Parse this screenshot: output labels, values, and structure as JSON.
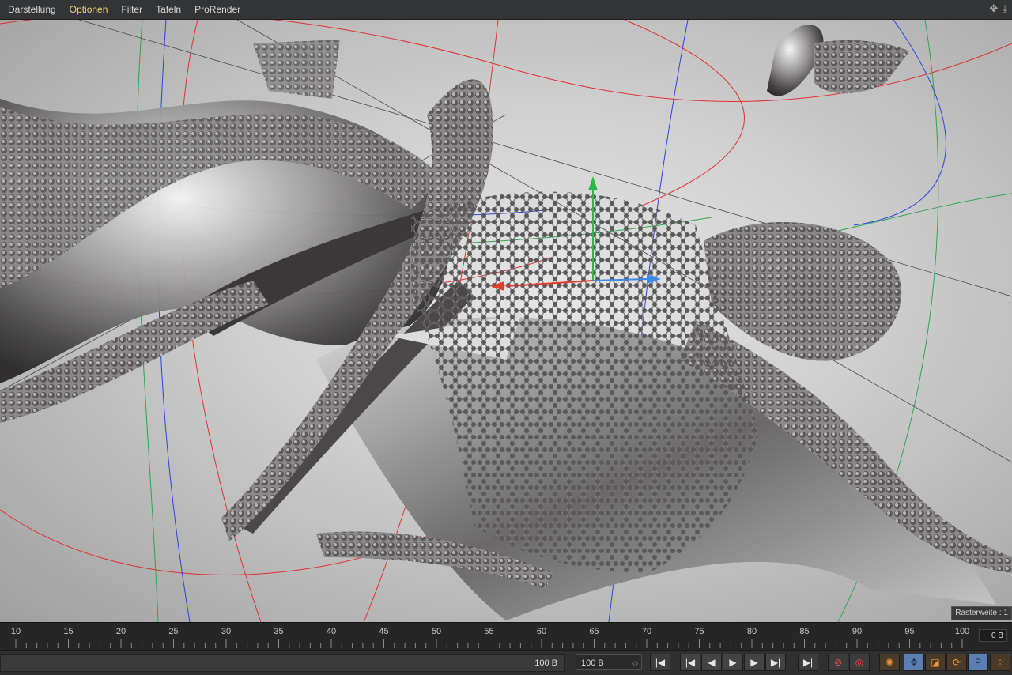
{
  "menu": {
    "items": [
      "Darstellung",
      "Optionen",
      "Filter",
      "Tafeln",
      "ProRender"
    ],
    "active_index": 1,
    "active_color": "#f0d46c",
    "icons": [
      "move-view-icon",
      "download-view-icon"
    ]
  },
  "viewport": {
    "raster_label": "Rasterweite : 1",
    "axis_colors": {
      "x": "#e83a2a",
      "y": "#2ab84a",
      "z": "#3a8ae8"
    }
  },
  "timeline": {
    "ticks": [
      "10",
      "15",
      "20",
      "25",
      "30",
      "35",
      "40",
      "45",
      "50",
      "55",
      "60",
      "65",
      "70",
      "75",
      "80",
      "85",
      "90",
      "95",
      "100"
    ],
    "current_frame": "0 B"
  },
  "controls": {
    "track_value": "100 B",
    "field_value": "100 B",
    "buttons": [
      {
        "name": "go-to-start-button",
        "glyph": "|◀"
      },
      {
        "name": "previous-key-button",
        "glyph": "|◀"
      },
      {
        "name": "previous-frame-button",
        "glyph": "◀"
      },
      {
        "name": "play-button",
        "glyph": "▶"
      },
      {
        "name": "next-frame-button",
        "glyph": "▶"
      },
      {
        "name": "next-key-button",
        "glyph": "▶|"
      },
      {
        "name": "go-to-end-button",
        "glyph": "▶|"
      },
      {
        "name": "record-keyframe-button",
        "glyph": "⊘"
      },
      {
        "name": "auto-keyframe-button",
        "glyph": "◎"
      },
      {
        "name": "keyframe-selection-button",
        "glyph": "✺"
      },
      {
        "name": "move-key-button",
        "glyph": "✥"
      },
      {
        "name": "scale-key-button",
        "glyph": "◪"
      },
      {
        "name": "rotate-key-button",
        "glyph": "⟳"
      },
      {
        "name": "parameter-key-button",
        "glyph": "P"
      },
      {
        "name": "point-level-button",
        "glyph": "⁘"
      }
    ]
  }
}
